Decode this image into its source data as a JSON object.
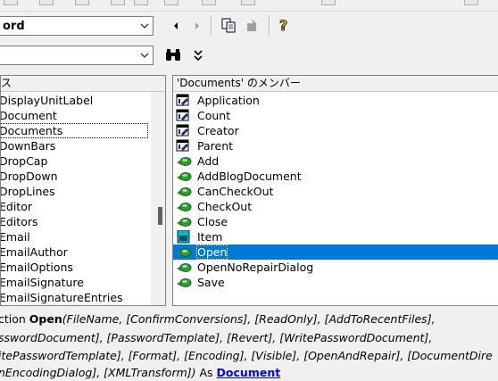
{
  "toolbar": {
    "library_combo_value": "ord",
    "search_combo_value": ""
  },
  "classes_pane": {
    "header": "ス",
    "items": [
      "DisplayUnitLabel",
      "Document",
      "Documents",
      "DownBars",
      "DropCap",
      "DropDown",
      "DropLines",
      "Editor",
      "Editors",
      "Email",
      "EmailAuthor",
      "EmailOptions",
      "EmailSignature",
      "EmailSignatureEntries"
    ],
    "selected_index": 2
  },
  "members_pane": {
    "header": "'Documents' のメンバー",
    "items": [
      {
        "label": "Application",
        "icon": "property-icon"
      },
      {
        "label": "Count",
        "icon": "property-icon"
      },
      {
        "label": "Creator",
        "icon": "property-icon"
      },
      {
        "label": "Parent",
        "icon": "property-icon"
      },
      {
        "label": "Add",
        "icon": "method-icon"
      },
      {
        "label": "AddBlogDocument",
        "icon": "method-icon"
      },
      {
        "label": "CanCheckOut",
        "icon": "method-icon"
      },
      {
        "label": "CheckOut",
        "icon": "method-icon"
      },
      {
        "label": "Close",
        "icon": "method-icon"
      },
      {
        "label": "Item",
        "icon": "default-member-icon"
      },
      {
        "label": "Open",
        "icon": "method-icon"
      },
      {
        "label": "OpenNoRepairDialog",
        "icon": "method-icon"
      },
      {
        "label": "Save",
        "icon": "method-icon"
      }
    ],
    "selected_index": 10
  },
  "details": {
    "line1": {
      "prefix": "ction ",
      "name": "Open",
      "params": "(FileName, [ConfirmConversions], [ReadOnly], [AddToRecentFiles],"
    },
    "line2": "sswordDocument], [PasswordTemplate], [Revert], [WritePasswordDocument],",
    "line3": "itePasswordTemplate], [Format], [Encoding], [Visible], [OpenAndRepair], [DocumentDire",
    "line4": {
      "text": "nEncodingDialog], [XMLTransform])",
      "as": " As ",
      "type_link": "Document"
    }
  }
}
